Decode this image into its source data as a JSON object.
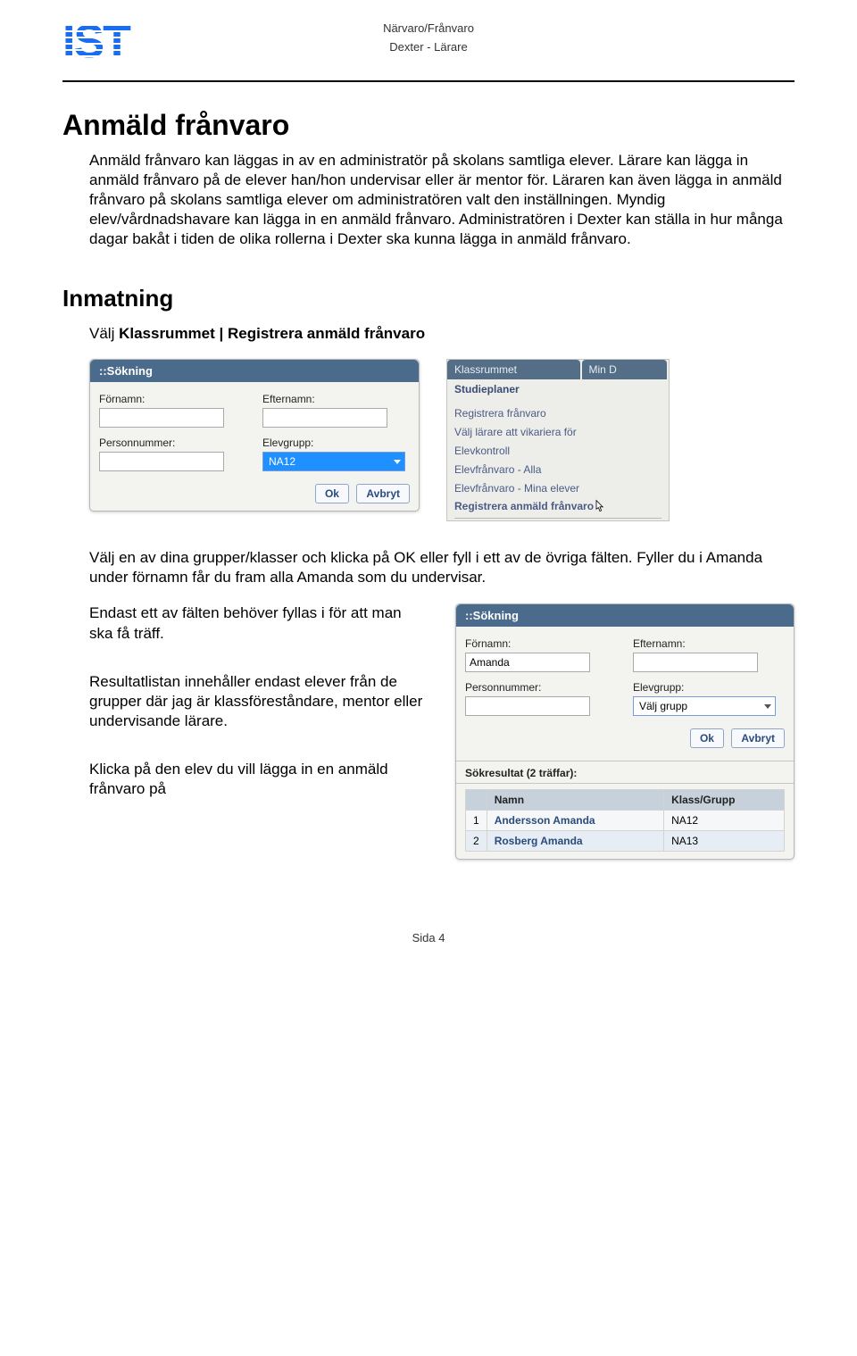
{
  "header": {
    "title1": "Närvaro/Frånvaro",
    "title2": "Dexter - Lärare"
  },
  "main": {
    "h1": "Anmäld frånvaro",
    "para": "Anmäld frånvaro kan läggas in av en administratör på skolans samtliga elever. Lärare kan lägga in anmäld frånvaro på de elever han/hon undervisar eller är mentor för. Läraren kan även lägga in anmäld frånvaro på skolans samtliga elever om administratören valt den inställningen. Myndig elev/vårdnadshavare kan lägga in en anmäld frånvaro. Administratören i Dexter kan ställa in hur många dagar bakåt i tiden de olika rollerna i Dexter ska kunna lägga in anmäld frånvaro."
  },
  "inmatning": {
    "h2": "Inmatning",
    "instr_prefix": "Välj ",
    "instr_bold": "Klassrummet | Registrera anmäld frånvaro",
    "search_panel": {
      "title": "::Sökning",
      "fornamn_label": "Förnamn:",
      "efternamn_label": "Efternamn:",
      "personnummer_label": "Personnummer:",
      "elevgrupp_label": "Elevgrupp:",
      "elevgrupp_value": "NA12",
      "ok": "Ok",
      "avbryt": "Avbryt"
    },
    "menu": {
      "tab1": "Klassrummet",
      "tab2": "Min D",
      "studieplaner": "Studieplaner",
      "items": [
        "Registrera frånvaro",
        "Välj lärare att vikariera för",
        "Elevkontroll",
        "Elevfrånvaro - Alla",
        "Elevfrånvaro - Mina elever",
        "Registrera anmäld frånvaro"
      ]
    },
    "post_text": "Välj en av dina grupper/klasser och klicka på OK eller fyll i ett av de övriga fälten. Fyller du i Amanda under förnamn får du fram alla Amanda som du undervisar."
  },
  "lower": {
    "leftParas": [
      "Endast ett av fälten behöver fyllas i för att man ska få träff.",
      "Resultatlistan innehåller endast elever från de grupper där jag är klassföreståndare, mentor eller undervisande lärare.",
      "Klicka på den elev du vill lägga in en anmäld frånvaro på"
    ],
    "search_panel": {
      "title": "::Sökning",
      "fornamn_label": "Förnamn:",
      "fornamn_value": "Amanda",
      "efternamn_label": "Efternamn:",
      "personnummer_label": "Personnummer:",
      "elevgrupp_label": "Elevgrupp:",
      "elevgrupp_value": "Välj grupp",
      "ok": "Ok",
      "avbryt": "Avbryt",
      "results_header": "Sökresultat (2 träffar):",
      "cols": {
        "namn": "Namn",
        "klass": "Klass/Grupp"
      },
      "rows": [
        {
          "idx": "1",
          "namn": "Andersson Amanda",
          "klass": "NA12"
        },
        {
          "idx": "2",
          "namn": "Rosberg Amanda",
          "klass": "NA13"
        }
      ]
    }
  },
  "footer": "Sida 4"
}
